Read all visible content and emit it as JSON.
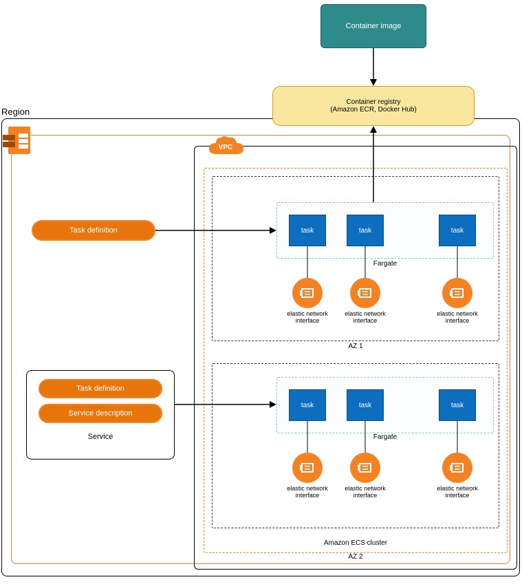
{
  "container_image": {
    "label": "Container image"
  },
  "container_registry": {
    "title": "Container registry",
    "subtitle": "(Amazon ECR, Docker Hub)"
  },
  "region": {
    "label": "Region"
  },
  "vpc": {
    "label": "VPC"
  },
  "ecs_cluster": {
    "label": "Amazon ECS cluster"
  },
  "az1": {
    "label": "AZ 1",
    "fargate_label": "Fargate",
    "tasks": [
      "task",
      "task",
      "task"
    ],
    "eni_label": "elastic network interface"
  },
  "az2": {
    "label": "AZ 2",
    "fargate_label": "Fargate",
    "tasks": [
      "task",
      "task",
      "task"
    ],
    "eni_label": "elastic network interface"
  },
  "task_definition_1": {
    "label": "Task definition"
  },
  "service": {
    "task_definition": "Task definition",
    "service_description": "Service description",
    "label": "Service"
  }
}
